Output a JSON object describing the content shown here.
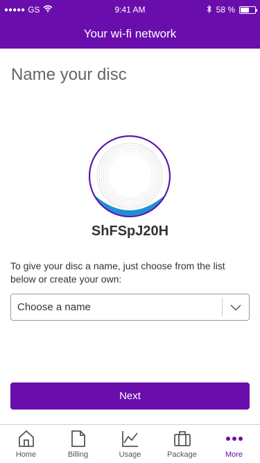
{
  "status_bar": {
    "carrier": "GS",
    "time": "9:41 AM",
    "battery_percent": "58 %",
    "battery_level": 0.58
  },
  "nav": {
    "title": "Your wi-fi network"
  },
  "page": {
    "title": "Name your disc",
    "device_name": "ShFSpJ20H",
    "instructions": "To give your disc a name, just choose from the list below or create your own:"
  },
  "select": {
    "value": "Choose a name"
  },
  "actions": {
    "next_label": "Next"
  },
  "tabs": [
    {
      "label": "Home",
      "icon": "home-icon"
    },
    {
      "label": "Billing",
      "icon": "billing-icon"
    },
    {
      "label": "Usage",
      "icon": "usage-icon"
    },
    {
      "label": "Package",
      "icon": "package-icon"
    },
    {
      "label": "More",
      "icon": "more-icon",
      "active": true
    }
  ],
  "colors": {
    "brand": "#6a0dad",
    "disc_accent": "#1e90d6"
  }
}
